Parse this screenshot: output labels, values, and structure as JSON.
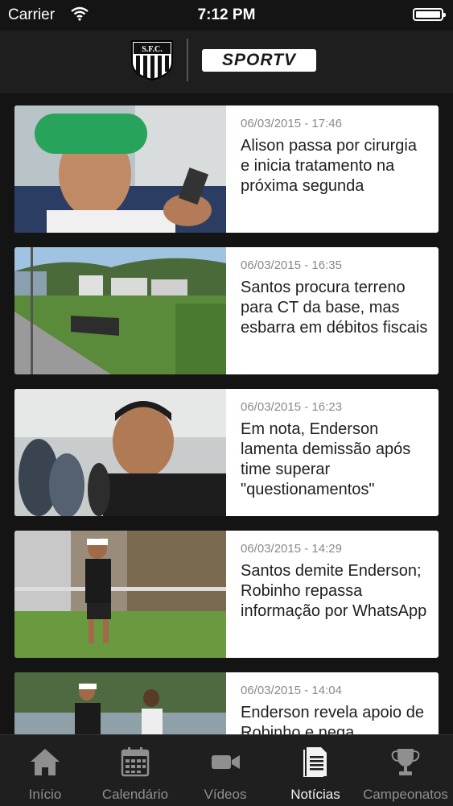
{
  "status": {
    "carrier": "Carrier",
    "time": "7:12 PM"
  },
  "header": {
    "brand": "SPORTV",
    "crest_name": "santos-crest"
  },
  "news": [
    {
      "date": "06/03/2015 - 17:46",
      "title": "Alison passa por cirurgia e inicia tratamento na próxima segunda"
    },
    {
      "date": "06/03/2015 - 16:35",
      "title": "Santos procura terreno para CT da base, mas esbarra em débitos fiscais"
    },
    {
      "date": "06/03/2015 - 16:23",
      "title": "Em nota, Enderson lamenta demissão após time superar \"questionamentos\""
    },
    {
      "date": "06/03/2015 - 14:29",
      "title": "Santos demite Enderson; Robinho repassa informação por WhatsApp"
    },
    {
      "date": "06/03/2015 - 14:04",
      "title": "Enderson revela apoio de Robinho e nega"
    }
  ],
  "tabs": [
    {
      "label": "Início",
      "icon": "home-icon"
    },
    {
      "label": "Calendário",
      "icon": "calendar-icon"
    },
    {
      "label": "Vídeos",
      "icon": "video-camera-icon"
    },
    {
      "label": "Notícias",
      "icon": "news-document-icon",
      "active": true
    },
    {
      "label": "Campeonatos",
      "icon": "trophy-icon"
    }
  ],
  "colors": {
    "background": "#141414",
    "tabbar": "#1f1f1f",
    "active_tab": "#f2f2f2",
    "inactive_tab": "#8f8f8f"
  }
}
